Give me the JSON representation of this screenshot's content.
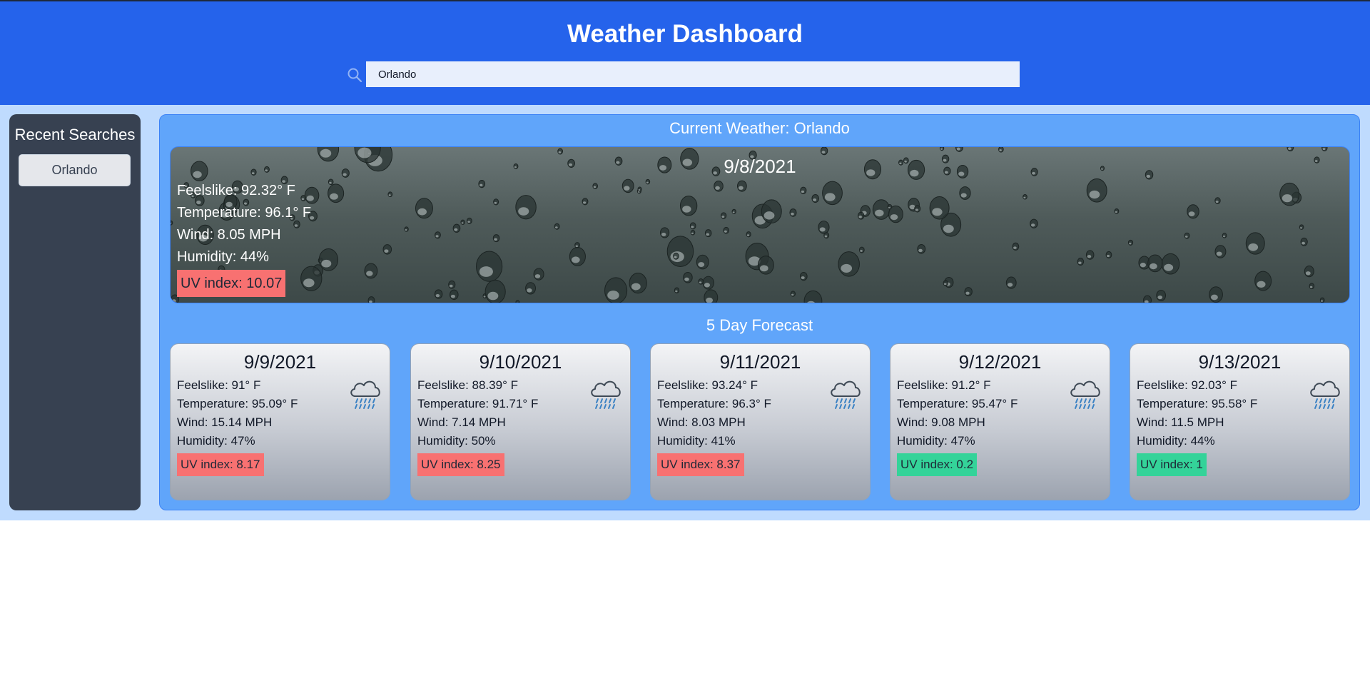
{
  "header": {
    "title": "Weather Dashboard",
    "search": {
      "value": "Orlando",
      "placeholder": ""
    },
    "search_icon": "search-icon"
  },
  "sidebar": {
    "title": "Recent Searches",
    "recent": [
      {
        "label": "Orlando"
      }
    ]
  },
  "current": {
    "title": "Current Weather: Orlando",
    "date": "9/8/2021",
    "feelslike": "Feelslike: 92.32° F",
    "temperature": "Temperature: 96.1° F",
    "wind": "Wind: 8.05 MPH",
    "humidity": "Humidity: 44%",
    "uv": "UV index: 10.07",
    "uv_level": "high",
    "background": "rain-drops-image"
  },
  "forecast": {
    "title": "5 Day Forecast",
    "days": [
      {
        "date": "9/9/2021",
        "feelslike": "Feelslike: 91° F",
        "temperature": "Temperature: 95.09° F",
        "wind": "Wind: 15.14 MPH",
        "humidity": "Humidity: 47%",
        "uv": "UV index: 8.17",
        "uv_level": "high",
        "icon": "rain-cloud-icon"
      },
      {
        "date": "9/10/2021",
        "feelslike": "Feelslike: 88.39° F",
        "temperature": "Temperature: 91.71° F",
        "wind": "Wind: 7.14 MPH",
        "humidity": "Humidity: 50%",
        "uv": "UV index: 8.25",
        "uv_level": "high",
        "icon": "rain-cloud-icon"
      },
      {
        "date": "9/11/2021",
        "feelslike": "Feelslike: 93.24° F",
        "temperature": "Temperature: 96.3° F",
        "wind": "Wind: 8.03 MPH",
        "humidity": "Humidity: 41%",
        "uv": "UV index: 8.37",
        "uv_level": "high",
        "icon": "rain-cloud-icon"
      },
      {
        "date": "9/12/2021",
        "feelslike": "Feelslike: 91.2° F",
        "temperature": "Temperature: 95.47° F",
        "wind": "Wind: 9.08 MPH",
        "humidity": "Humidity: 47%",
        "uv": "UV index: 0.2",
        "uv_level": "low",
        "icon": "rain-cloud-icon"
      },
      {
        "date": "9/13/2021",
        "feelslike": "Feelslike: 92.03° F",
        "temperature": "Temperature: 95.58° F",
        "wind": "Wind: 11.5 MPH",
        "humidity": "Humidity: 44%",
        "uv": "UV index: 1",
        "uv_level": "low",
        "icon": "rain-cloud-icon"
      }
    ]
  },
  "colors": {
    "header": "#2563eb",
    "page_bg": "#bfdbfe",
    "sidebar": "#374151",
    "content": "#60a5fa",
    "uv_high": "#f87171",
    "uv_low": "#34d399"
  }
}
